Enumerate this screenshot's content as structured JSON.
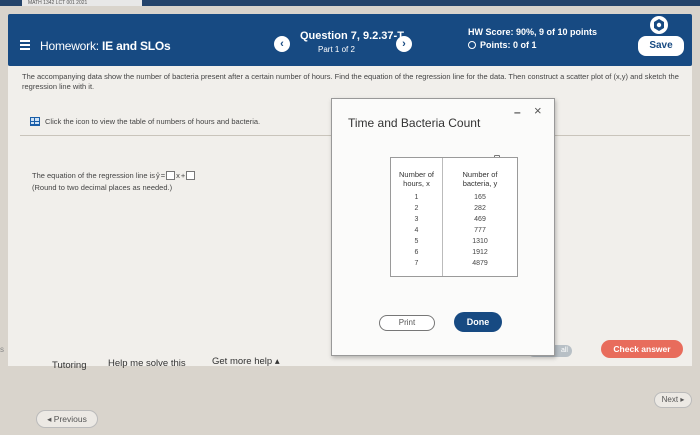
{
  "browser_tab": "MATH 1342 LCT 001 2021",
  "header": {
    "homework_prefix": "Homework:",
    "homework_title": "IE and SLOs",
    "question": "Question 7, 9.2.37-T",
    "part": "Part 1 of 2",
    "hw_score": "HW Score: 90%, 9 of 10 points",
    "points": "Points: 0 of 1",
    "save_label": "Save"
  },
  "main": {
    "instructions": "The accompanying data show the number of bacteria present after a certain number of hours. Find the equation of the regression line for the data. Then construct a scatter plot of (x,y) and sketch the regression line with it.",
    "table_link": "Click the icon to view the table of numbers of hours and bacteria.",
    "equation_prefix": "The equation of the regression line is",
    "equation_yhat": "ŷ",
    "equation_equals": "=",
    "equation_x": "x",
    "equation_plus": "+",
    "round_note": "(Round to two decimal places as needed.)"
  },
  "dialog": {
    "title": "Time and Bacteria Count",
    "minimize": "–",
    "close": "×",
    "col_x_header_1": "Number of",
    "col_x_header_2": "hours, x",
    "col_y_header_1": "Number of",
    "col_y_header_2": "bacteria, y",
    "x_values": [
      "1",
      "2",
      "3",
      "4",
      "5",
      "6",
      "7"
    ],
    "y_values": [
      "165",
      "282",
      "469",
      "777",
      "1310",
      "1912",
      "4879"
    ],
    "print_label": "Print",
    "done_label": "Done"
  },
  "footer": {
    "left_mark": "s",
    "tutoring": "Tutoring",
    "solve": "Help me solve this",
    "more_help": "Get more help ▴",
    "view_all": "all",
    "check_answer": "Check answer",
    "previous": "◂ Previous",
    "next": "Next ▸"
  },
  "colors": {
    "header_blue": "#174a82",
    "check_answer_red": "#e86c5c"
  }
}
